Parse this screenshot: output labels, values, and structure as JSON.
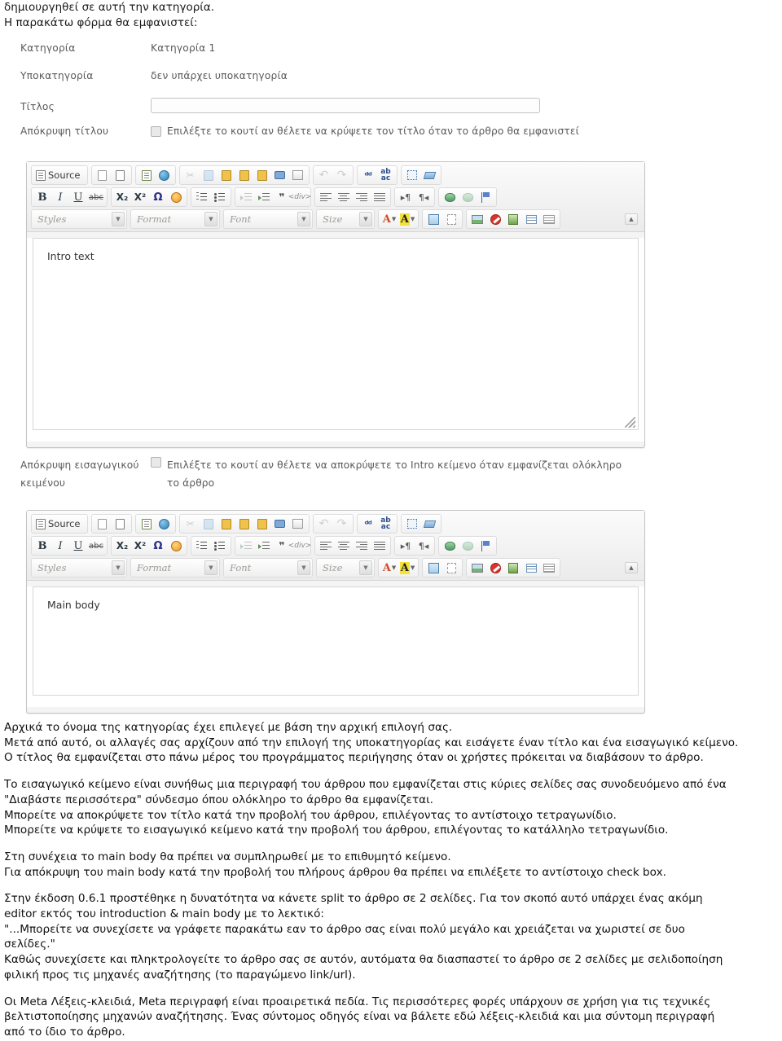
{
  "intro": {
    "line1": "δημιουργηθεί σε αυτή την κατηγορία.",
    "line2": "Η παρακάτω φόρμα θα εμφανιστεί:"
  },
  "form": {
    "category": {
      "label": "Κατηγορία",
      "value": "Κατηγορία 1"
    },
    "subcategory": {
      "label": "Υποκατηγορία",
      "value": "δεν υπάρχει υποκατηγορία"
    },
    "title": {
      "label": "Τίτλος",
      "value": "",
      "placeholder": ""
    },
    "hide_title": {
      "label": "Απόκρυψη τίτλου",
      "checkbox_text": "Επιλέξτε το κουτί αν θέλετε να κρύψετε τον τίτλο όταν το άρθρο θα εμφανιστεί",
      "checked": false
    },
    "hide_intro": {
      "label_line1": "Απόκρυψη εισαγωγικού",
      "label_line2": "κειμένου",
      "checkbox_text_line1": "Επιλέξτε το κουτί αν θέλετε να αποκρύψετε το Intro κείμενο όταν εμφανίζεται ολόκληρο",
      "checkbox_text_line2": "το άρθρο",
      "checked": false
    }
  },
  "editors": [
    {
      "name": "intro-editor",
      "content": "Intro text"
    },
    {
      "name": "main-body-editor",
      "content": "Main body"
    }
  ],
  "toolbar": {
    "source_label": "Source",
    "combos": [
      {
        "name": "styles",
        "label": "Styles"
      },
      {
        "name": "format",
        "label": "Format"
      },
      {
        "name": "font",
        "label": "Font"
      },
      {
        "name": "size",
        "label": "Size"
      }
    ],
    "row1_icons": [
      "source-icon",
      "new-page-icon",
      "preview-icon",
      "templates-icon",
      "page-globe-icon",
      "cut-icon",
      "copy-icon",
      "paste-icon",
      "paste-text-icon",
      "paste-word-icon",
      "print-icon",
      "spell-check-icon",
      "undo-icon",
      "redo-icon",
      "find-icon",
      "replace-icon",
      "select-all-icon",
      "remove-format-icon"
    ],
    "row2_icons": [
      "bold-icon",
      "italic-icon",
      "underline-icon",
      "strikethrough-icon",
      "subscript-icon",
      "superscript-icon",
      "special-char-icon",
      "smiley-icon",
      "numbered-list-icon",
      "bulleted-list-icon",
      "outdent-icon",
      "indent-icon",
      "blockquote-icon",
      "create-div-icon",
      "align-left-icon",
      "align-center-icon",
      "align-right-icon",
      "align-justify-icon",
      "ltr-icon",
      "rtl-icon",
      "link-icon",
      "unlink-icon",
      "anchor-icon"
    ],
    "row3_icons": [
      "text-color-icon",
      "bg-color-icon",
      "maximize-icon",
      "show-blocks-icon",
      "image-icon",
      "no-entry-icon",
      "flash-icon",
      "table-icon",
      "horizontal-rule-icon",
      "collapse-toolbar-icon"
    ]
  },
  "body_copy": [
    {
      "lines": [
        "Αρχικά το όνομα της κατηγορίας έχει επιλεγεί με βάση την αρχική επιλογή σας.",
        "Μετά από αυτό, οι αλλαγές σας αρχίζουν από την επιλογή της υποκατηγορίας και εισάγετε έναν τίτλο και ένα εισαγωγικό κείμενο.",
        "Ο τίτλος θα εμφανίζεται στο πάνω μέρος του προγράμματος περιήγησης όταν οι χρήστες πρόκειται να διαβάσουν το άρθρο."
      ]
    },
    {
      "lines": [
        "Το εισαγωγικό κείμενο είναι συνήθως μια περιγραφή του άρθρου που εμφανίζεται στις κύριες σελίδες σας συνοδευόμενο από ένα",
        "\"Διαβάστε περισσότερα\" σύνδεσμο όπου ολόκληρο το άρθρο θα εμφανίζεται.",
        "Μπορείτε να αποκρύψετε τον τίτλο κατά την προβολή του άρθρου, επιλέγοντας το αντίστοιχο τετραγωνίδιο.",
        "Μπορείτε να κρύψετε το εισαγωγικό κείμενο κατά την προβολή του άρθρου, επιλέγοντας το κατάλληλο τετραγωνίδιο."
      ]
    },
    {
      "lines": [
        "Στη συνέχεια το main body θα πρέπει να συμπληρωθεί με το επιθυμητό κείμενο.",
        "Για απόκρυψη του main body κατά την προβολή του πλήρους άρθρου θα πρέπει να επιλέξετε το αντίστοιχο check box."
      ]
    },
    {
      "lines": [
        "Στην έκδοση 0.6.1 προστέθηκε η δυνατότητα να κάνετε split το άρθρο σε 2 σελίδες. Για τον σκοπό αυτό υπάρχει ένας ακόμη",
        "editor εκτός του introduction & main body με το λεκτικό:",
        "\"...Μπορείτε να συνεχίσετε να γράφετε παρακάτω εαν το άρθρο σας είναι πολύ μεγάλο και χρειάζεται να χωριστεί σε δυο",
        "σελίδες.\"",
        "Καθώς συνεχίσετε και πληκτρολογείτε το άρθρο σας σε αυτόν, αυτόματα θα διασπαστεί το άρθρο σε 2 σελίδες με σελιδοποίηση",
        "φιλική προς τις μηχανές αναζήτησης (το παραγώμενο link/url)."
      ]
    },
    {
      "lines": [
        "Οι Meta Λέξεις-κλειδιά, Meta περιγραφή είναι προαιρετικά πεδία. Τις περισσότερες φορές υπάρχουν σε χρήση για τις τεχνικές",
        "βελτιστοποίησης μηχανών αναζήτησης. Ένας σύντομος οδηγός είναι να βάλετε εδώ λέξεις-κλειδιά και μια σύντομη περιγραφή",
        "από το ίδιο το άρθρο."
      ]
    }
  ],
  "colors": {
    "editor_chrome": "#f4f4f4",
    "editor_border": "#c4c4c4",
    "text": "#111111",
    "form_label": "#5a5a5a",
    "accent_blue": "#2d4f8e"
  }
}
